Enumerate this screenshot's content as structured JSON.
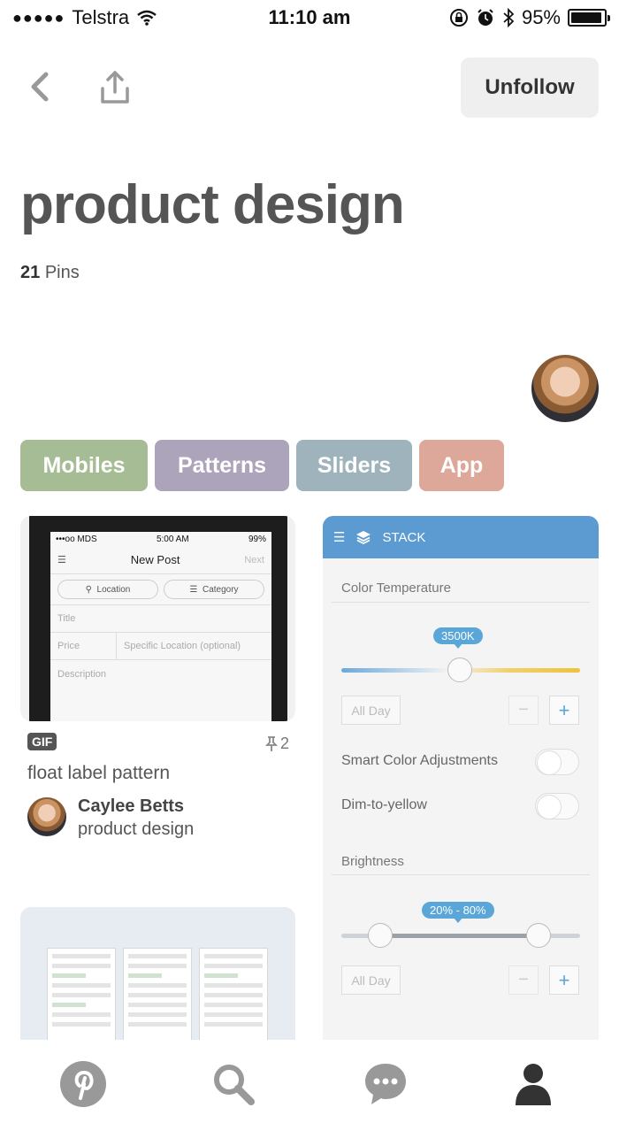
{
  "status_bar": {
    "carrier": "Telstra",
    "time": "11:10 am",
    "battery": "95%",
    "battery_level": 0.95
  },
  "header": {
    "unfollow_label": "Unfollow"
  },
  "board": {
    "title": "product design",
    "pin_count": "21",
    "pin_label": "Pins"
  },
  "tags": [
    {
      "label": "Mobiles",
      "color": "#a6bc94"
    },
    {
      "label": "Patterns",
      "color": "#aca4ba"
    },
    {
      "label": "Sliders",
      "color": "#9fb3bd"
    },
    {
      "label": "App",
      "color": "#dda89a"
    }
  ],
  "pin1": {
    "badge": "GIF",
    "repin_count": "2",
    "description": "float label pattern",
    "pinner_name": "Caylee Betts",
    "pinner_board": "product design",
    "mock": {
      "status_left": "•••oo MDS",
      "status_time": "5:00 AM",
      "status_right": "99%",
      "nav_title": "New Post",
      "nav_next": "Next",
      "chip_location": "Location",
      "chip_category": "Category",
      "field_title": "Title",
      "field_price": "Price",
      "field_location": "Specific Location (optional)",
      "field_description": "Description"
    }
  },
  "pin2": {
    "app_name": "STACK",
    "color_temp_label": "Color Temperature",
    "color_temp_value": "3500K",
    "all_day_1": "All Day",
    "smart_color": "Smart Color Adjustments",
    "dim_to_yellow": "Dim-to-yellow",
    "brightness_label": "Brightness",
    "brightness_value": "20% - 80%",
    "all_day_2": "All Day",
    "plus": "+",
    "minus": "−"
  },
  "tabbar": {
    "icons": [
      "pinterest-logo-icon",
      "search-icon",
      "chat-icon",
      "profile-icon"
    ]
  }
}
